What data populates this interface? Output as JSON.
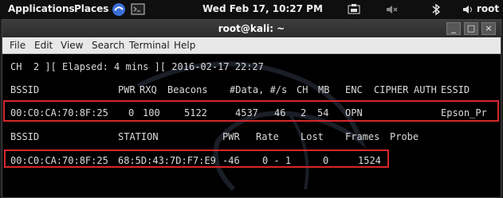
{
  "sysbar": {
    "applications": "Applications",
    "places": "Places",
    "datetime": "Wed Feb 17, 10:27 PM",
    "user": "root",
    "icons": [
      "kali-icon",
      "terminal-icon",
      "screenshot-icon",
      "mute-icon",
      "bluetooth-icon",
      "speaker-icon"
    ]
  },
  "window": {
    "title": "root@kali: ~",
    "buttons": {
      "minimize": "_",
      "maximize": "□",
      "close": "×"
    }
  },
  "menu": [
    "File",
    "Edit",
    "View",
    "Search",
    "Terminal",
    "Help"
  ],
  "terminal": {
    "status_line": "CH  2 ][ Elapsed: 4 mins ][ 2016-02-17 22:27",
    "ap_headers": [
      "BSSID",
      "PWR",
      "RXQ",
      "Beacons",
      "#Data, #/s",
      "CH",
      "MB",
      "ENC",
      "CIPHER",
      "AUTH",
      "ESSID"
    ],
    "ap_row": {
      "bssid": "00:C0:CA:70:8F:25",
      "pwr": "0",
      "rxq": "100",
      "beacons": "5122",
      "data": "4537",
      "per_s": "46",
      "ch": "2",
      "mb": "54",
      "enc": "OPN",
      "cipher": "",
      "auth": "",
      "essid": "Epson_Pr"
    },
    "sta_headers": [
      "BSSID",
      "STATION",
      "PWR",
      "Rate",
      "Lost",
      "Frames",
      "Probe"
    ],
    "sta_row": {
      "bssid": "00:C0:CA:70:8F:25",
      "station": "68:5D:43:7D:F7:E9",
      "pwr": "-46",
      "rate": "0 - 1",
      "lost": "0",
      "frames": "1524",
      "probe": ""
    }
  },
  "colors": {
    "highlight": "#d6262c",
    "terminal_bg": "#000000",
    "terminal_fg": "#dcdcdc"
  }
}
